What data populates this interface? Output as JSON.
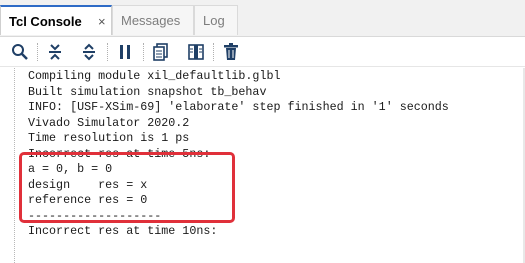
{
  "tabs": [
    {
      "label": "Tcl Console",
      "close": "×"
    },
    {
      "label": "Messages"
    },
    {
      "label": "Log"
    }
  ],
  "toolbar": {
    "icons": [
      "search-icon",
      "collapse-all-icon",
      "expand-all-icon",
      "pause-icon",
      "copy-icon",
      "columns-icon",
      "delete-icon"
    ]
  },
  "console": {
    "lines": [
      "Compiling module xil_defaultlib.glbl",
      "Built simulation snapshot tb_behav",
      "INFO: [USF-XSim-69] 'elaborate' step finished in '1' seconds",
      "Vivado Simulator 2020.2",
      "Time resolution is 1 ps",
      "Incorrect res at time 5ns:",
      "a = 0, b = 0",
      "design    res = x",
      "reference res = 0",
      "-------------------",
      "Incorrect res at time 10ns:"
    ]
  },
  "colors": {
    "highlight": "#e0303a",
    "active_tab_accent": "#2e6bc6"
  }
}
